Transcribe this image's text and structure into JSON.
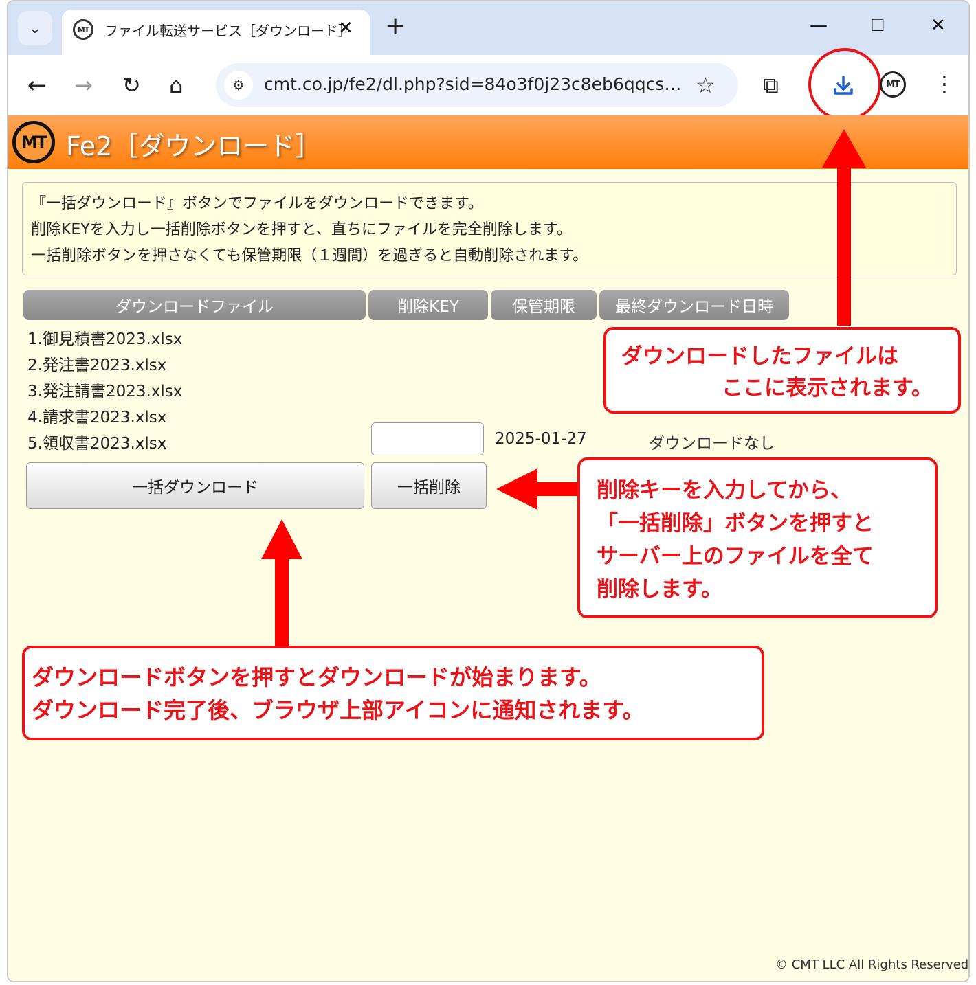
{
  "browser": {
    "tab_title": "ファイル転送サービス［ダウンロード］",
    "favicon_text": "MT",
    "url": "cmt.co.jp/fe2/dl.php?sid=84o3f0j23c8eb6qqcs9e...",
    "profile_text": "MT"
  },
  "site": {
    "logo_text": "MT",
    "title": "Fe2［ダウンロード］",
    "info_lines": [
      "『一括ダウンロード』ボタンでファイルをダウンロードできます。",
      "削除KEYを入力し一括削除ボタンを押すと、直ちにファイルを完全削除します。",
      "一括削除ボタンを押さなくても保管期限（１週間）を過ぎると自動削除されます。"
    ],
    "table": {
      "headers": [
        "ダウンロードファイル",
        "削除KEY",
        "保管期限",
        "最終ダウンロード日時"
      ],
      "files": [
        "1.御見積書2023.xlsx",
        "2.発注書2023.xlsx",
        "3.発注請書2023.xlsx",
        "4.請求書2023.xlsx",
        "5.領収書2023.xlsx"
      ],
      "delete_key_value": "",
      "expiry": "2025-01-27",
      "last_download": "ダウンロードなし"
    },
    "buttons": {
      "bulk_download": "一括ダウンロード",
      "bulk_delete": "一括削除"
    },
    "copyright": "© CMT LLC All Rights Reserved."
  },
  "annotations": {
    "download_location": [
      "ダウンロードしたファイルは",
      "ここに表示されます。"
    ],
    "delete_note": [
      "削除キーを入力してから、",
      "「一括削除」ボタンを押すと",
      "サーバー上のファイルを全て",
      "削除します。"
    ],
    "download_note": [
      "ダウンロードボタンを押すとダウンロードが始まります。",
      "ダウンロード完了後、ブラウザ上部アイコンに通知されます。"
    ]
  },
  "colors": {
    "accent_red": "#e8141a",
    "header_orange": "#ff7f0a",
    "page_bg": "#fffde3",
    "download_icon_blue": "#1a5fd0"
  }
}
